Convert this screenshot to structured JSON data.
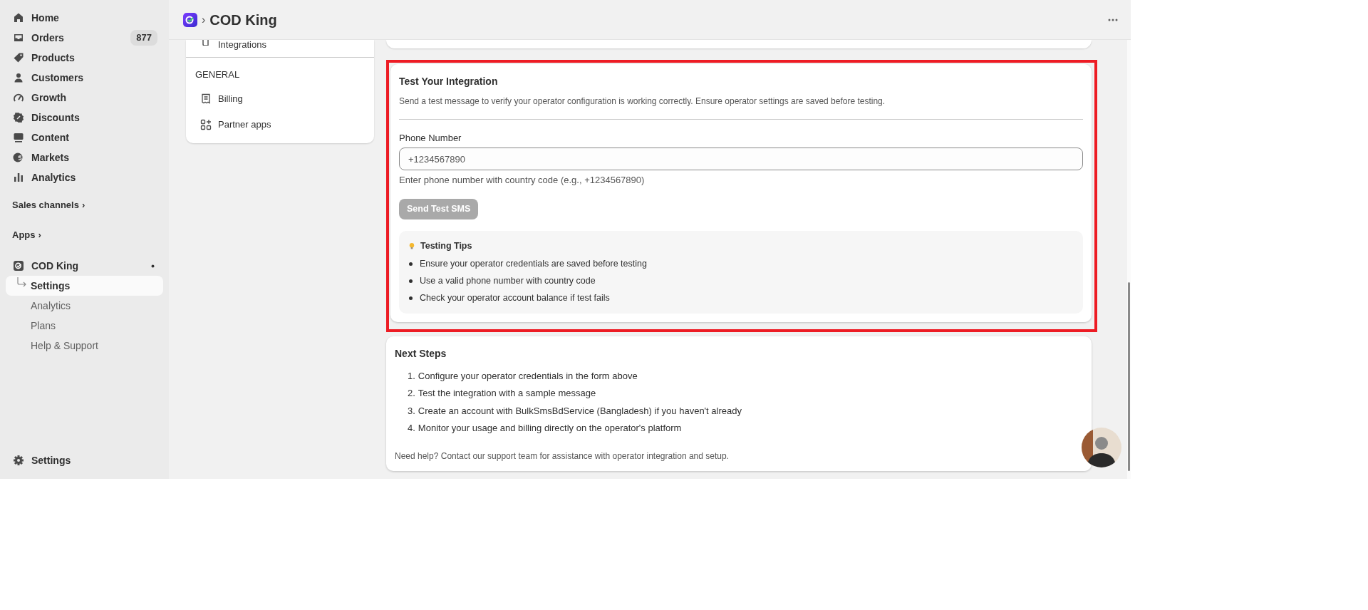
{
  "sidebar": {
    "items": [
      {
        "label": "Home"
      },
      {
        "label": "Orders",
        "badge": "877"
      },
      {
        "label": "Products"
      },
      {
        "label": "Customers"
      },
      {
        "label": "Growth"
      },
      {
        "label": "Discounts"
      },
      {
        "label": "Content"
      },
      {
        "label": "Markets"
      },
      {
        "label": "Analytics"
      }
    ],
    "sections": [
      {
        "label": "Sales channels",
        "chevron": "›"
      },
      {
        "label": "Apps",
        "chevron": "›"
      }
    ],
    "app": {
      "label": "COD King",
      "children": [
        {
          "label": "Settings",
          "selected": true
        },
        {
          "label": "Analytics",
          "selected": false
        },
        {
          "label": "Plans",
          "selected": false
        },
        {
          "label": "Help & Support",
          "selected": false
        }
      ]
    },
    "footer": {
      "label": "Settings"
    }
  },
  "top_bar": {
    "separator": "›",
    "title": "COD King"
  },
  "settings_nav": {
    "items": [
      {
        "label": "Integrations"
      }
    ],
    "section": "GENERAL",
    "general_items": [
      {
        "label": "Billing"
      },
      {
        "label": "Partner apps"
      }
    ]
  },
  "test_card": {
    "highlighted": true,
    "title": "Test Your Integration",
    "description": "Send a test message to verify your operator configuration is working correctly. Ensure operator settings are saved before testing.",
    "field": {
      "label": "Phone Number",
      "placeholder": "+1234567890",
      "help": "Enter phone number with country code (e.g., +1234567890)"
    },
    "button": {
      "label": "Send Test SMS",
      "disabled": true
    },
    "tips": {
      "title": "Testing Tips",
      "items": [
        "Ensure your operator credentials are saved before testing",
        "Use a valid phone number with country code",
        "Check your operator account balance if test fails"
      ]
    }
  },
  "next_steps": {
    "title": "Next Steps",
    "items": [
      {
        "number": "1.",
        "text": "Configure your operator credentials in the form above"
      },
      {
        "number": "2.",
        "text": "Test the integration with a sample message"
      },
      {
        "number": "3.",
        "text": "Create an account with BulkSmsBdService (Bangladesh) if you haven't already"
      },
      {
        "number": "4.",
        "text": "Monitor your usage and billing directly on the operator's platform"
      }
    ],
    "help": "Need help? Contact our support team for assistance with operator integration and setup."
  }
}
